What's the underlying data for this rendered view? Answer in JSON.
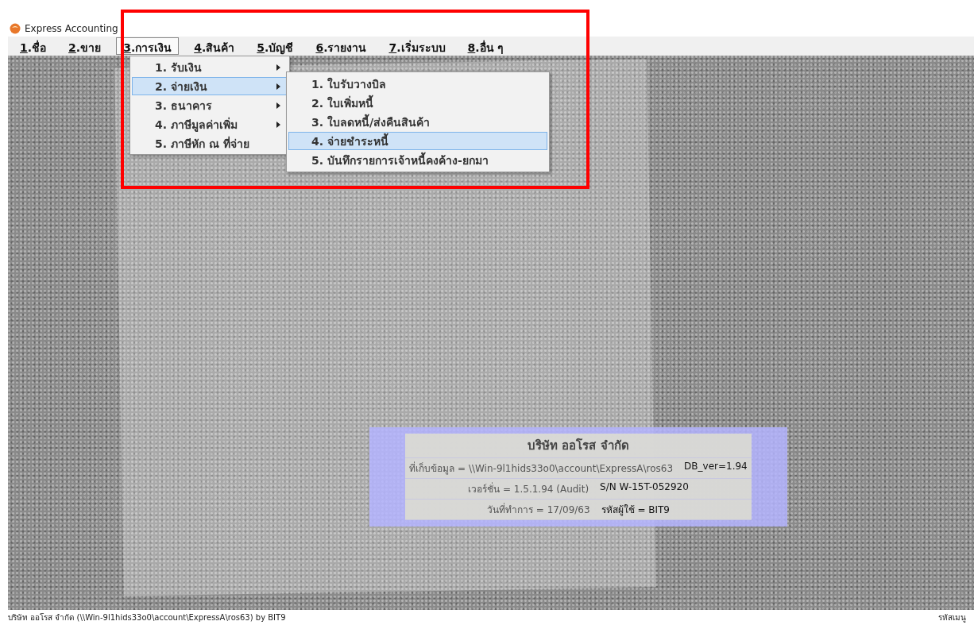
{
  "window": {
    "title": "Express Accounting"
  },
  "menu_bar": [
    {
      "key": "1",
      "label": ".ชื่อ",
      "selected": false
    },
    {
      "key": "2",
      "label": ".ขาย",
      "selected": false
    },
    {
      "key": "3",
      "label": ".การเงิน",
      "selected": true
    },
    {
      "key": "4",
      "label": ".สินค้า",
      "selected": false
    },
    {
      "key": "5",
      "label": ".บัญชี",
      "selected": false
    },
    {
      "key": "6",
      "label": ".รายงาน",
      "selected": false
    },
    {
      "key": "7",
      "label": ".เริ่มระบบ",
      "selected": false
    },
    {
      "key": "8",
      "label": ".อื่น ๆ",
      "selected": false
    }
  ],
  "dropdown": [
    {
      "label": "1. รับเงิน",
      "submenu": true,
      "selected": false
    },
    {
      "label": "2. จ่ายเงิน",
      "submenu": true,
      "selected": true
    },
    {
      "label": "3. ธนาคาร",
      "submenu": true,
      "selected": false
    },
    {
      "label": "4. ภาษีมูลค่าเพิ่ม",
      "submenu": true,
      "selected": false
    },
    {
      "label": "5. ภาษีหัก ณ ที่จ่าย",
      "submenu": false,
      "selected": false
    }
  ],
  "submenu": [
    {
      "label": "1. ใบรับวางบิล",
      "selected": false
    },
    {
      "label": "2. ใบเพิ่มหนี้",
      "selected": false
    },
    {
      "label": "3. ใบลดหนี้/ส่งคืนสินค้า",
      "selected": false
    },
    {
      "label": "4. จ่ายชำระหนี้",
      "selected": true
    },
    {
      "label": "5. บันทึกรายการเจ้าหนี้คงค้าง-ยกมา",
      "selected": false
    }
  ],
  "info_panel": {
    "company": "บริษัท ออโรส จำกัด",
    "lines": [
      [
        "ที่เก็บข้อมูล = \\\\Win-9l1hids33o0\\account\\ExpressA\\ros63",
        "DB_ver=1.94"
      ],
      [
        "เวอร์ชั่น =  1.5.1.94 (Audit)",
        "S/N W-15T-052920"
      ],
      [
        "วันที่ทำการ  =  17/09/63",
        "รหัสผู้ใช้  =  BIT9"
      ]
    ]
  },
  "status_bar": {
    "left": "บริษัท ออโรส จำกัด (\\\\Win-9l1hids33o0\\account\\ExpressA\\ros63) by BIT9",
    "right": "รหัสเมนู"
  }
}
